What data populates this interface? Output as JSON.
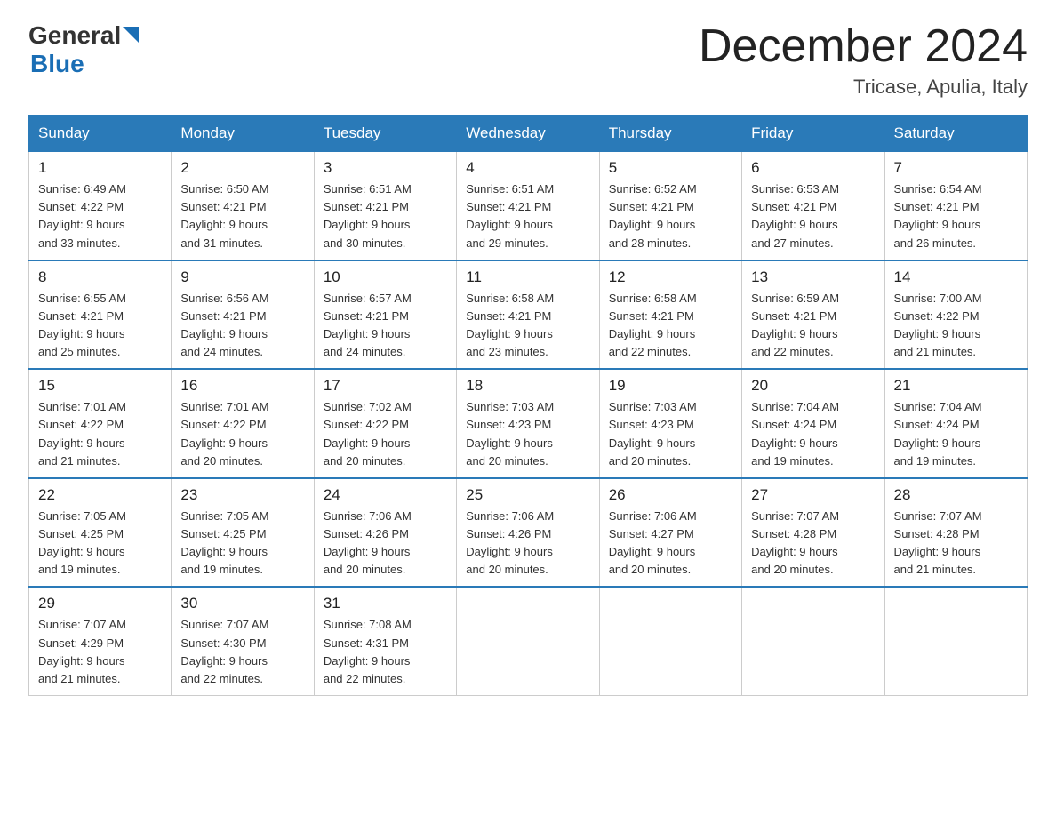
{
  "header": {
    "logo_general": "General",
    "logo_blue": "Blue",
    "month_title": "December 2024",
    "location": "Tricase, Apulia, Italy"
  },
  "weekdays": [
    "Sunday",
    "Monday",
    "Tuesday",
    "Wednesday",
    "Thursday",
    "Friday",
    "Saturday"
  ],
  "weeks": [
    [
      {
        "num": "1",
        "sunrise": "6:49 AM",
        "sunset": "4:22 PM",
        "daylight": "9 hours and 33 minutes."
      },
      {
        "num": "2",
        "sunrise": "6:50 AM",
        "sunset": "4:21 PM",
        "daylight": "9 hours and 31 minutes."
      },
      {
        "num": "3",
        "sunrise": "6:51 AM",
        "sunset": "4:21 PM",
        "daylight": "9 hours and 30 minutes."
      },
      {
        "num": "4",
        "sunrise": "6:51 AM",
        "sunset": "4:21 PM",
        "daylight": "9 hours and 29 minutes."
      },
      {
        "num": "5",
        "sunrise": "6:52 AM",
        "sunset": "4:21 PM",
        "daylight": "9 hours and 28 minutes."
      },
      {
        "num": "6",
        "sunrise": "6:53 AM",
        "sunset": "4:21 PM",
        "daylight": "9 hours and 27 minutes."
      },
      {
        "num": "7",
        "sunrise": "6:54 AM",
        "sunset": "4:21 PM",
        "daylight": "9 hours and 26 minutes."
      }
    ],
    [
      {
        "num": "8",
        "sunrise": "6:55 AM",
        "sunset": "4:21 PM",
        "daylight": "9 hours and 25 minutes."
      },
      {
        "num": "9",
        "sunrise": "6:56 AM",
        "sunset": "4:21 PM",
        "daylight": "9 hours and 24 minutes."
      },
      {
        "num": "10",
        "sunrise": "6:57 AM",
        "sunset": "4:21 PM",
        "daylight": "9 hours and 24 minutes."
      },
      {
        "num": "11",
        "sunrise": "6:58 AM",
        "sunset": "4:21 PM",
        "daylight": "9 hours and 23 minutes."
      },
      {
        "num": "12",
        "sunrise": "6:58 AM",
        "sunset": "4:21 PM",
        "daylight": "9 hours and 22 minutes."
      },
      {
        "num": "13",
        "sunrise": "6:59 AM",
        "sunset": "4:21 PM",
        "daylight": "9 hours and 22 minutes."
      },
      {
        "num": "14",
        "sunrise": "7:00 AM",
        "sunset": "4:22 PM",
        "daylight": "9 hours and 21 minutes."
      }
    ],
    [
      {
        "num": "15",
        "sunrise": "7:01 AM",
        "sunset": "4:22 PM",
        "daylight": "9 hours and 21 minutes."
      },
      {
        "num": "16",
        "sunrise": "7:01 AM",
        "sunset": "4:22 PM",
        "daylight": "9 hours and 20 minutes."
      },
      {
        "num": "17",
        "sunrise": "7:02 AM",
        "sunset": "4:22 PM",
        "daylight": "9 hours and 20 minutes."
      },
      {
        "num": "18",
        "sunrise": "7:03 AM",
        "sunset": "4:23 PM",
        "daylight": "9 hours and 20 minutes."
      },
      {
        "num": "19",
        "sunrise": "7:03 AM",
        "sunset": "4:23 PM",
        "daylight": "9 hours and 20 minutes."
      },
      {
        "num": "20",
        "sunrise": "7:04 AM",
        "sunset": "4:24 PM",
        "daylight": "9 hours and 19 minutes."
      },
      {
        "num": "21",
        "sunrise": "7:04 AM",
        "sunset": "4:24 PM",
        "daylight": "9 hours and 19 minutes."
      }
    ],
    [
      {
        "num": "22",
        "sunrise": "7:05 AM",
        "sunset": "4:25 PM",
        "daylight": "9 hours and 19 minutes."
      },
      {
        "num": "23",
        "sunrise": "7:05 AM",
        "sunset": "4:25 PM",
        "daylight": "9 hours and 19 minutes."
      },
      {
        "num": "24",
        "sunrise": "7:06 AM",
        "sunset": "4:26 PM",
        "daylight": "9 hours and 20 minutes."
      },
      {
        "num": "25",
        "sunrise": "7:06 AM",
        "sunset": "4:26 PM",
        "daylight": "9 hours and 20 minutes."
      },
      {
        "num": "26",
        "sunrise": "7:06 AM",
        "sunset": "4:27 PM",
        "daylight": "9 hours and 20 minutes."
      },
      {
        "num": "27",
        "sunrise": "7:07 AM",
        "sunset": "4:28 PM",
        "daylight": "9 hours and 20 minutes."
      },
      {
        "num": "28",
        "sunrise": "7:07 AM",
        "sunset": "4:28 PM",
        "daylight": "9 hours and 21 minutes."
      }
    ],
    [
      {
        "num": "29",
        "sunrise": "7:07 AM",
        "sunset": "4:29 PM",
        "daylight": "9 hours and 21 minutes."
      },
      {
        "num": "30",
        "sunrise": "7:07 AM",
        "sunset": "4:30 PM",
        "daylight": "9 hours and 22 minutes."
      },
      {
        "num": "31",
        "sunrise": "7:08 AM",
        "sunset": "4:31 PM",
        "daylight": "9 hours and 22 minutes."
      },
      null,
      null,
      null,
      null
    ]
  ]
}
